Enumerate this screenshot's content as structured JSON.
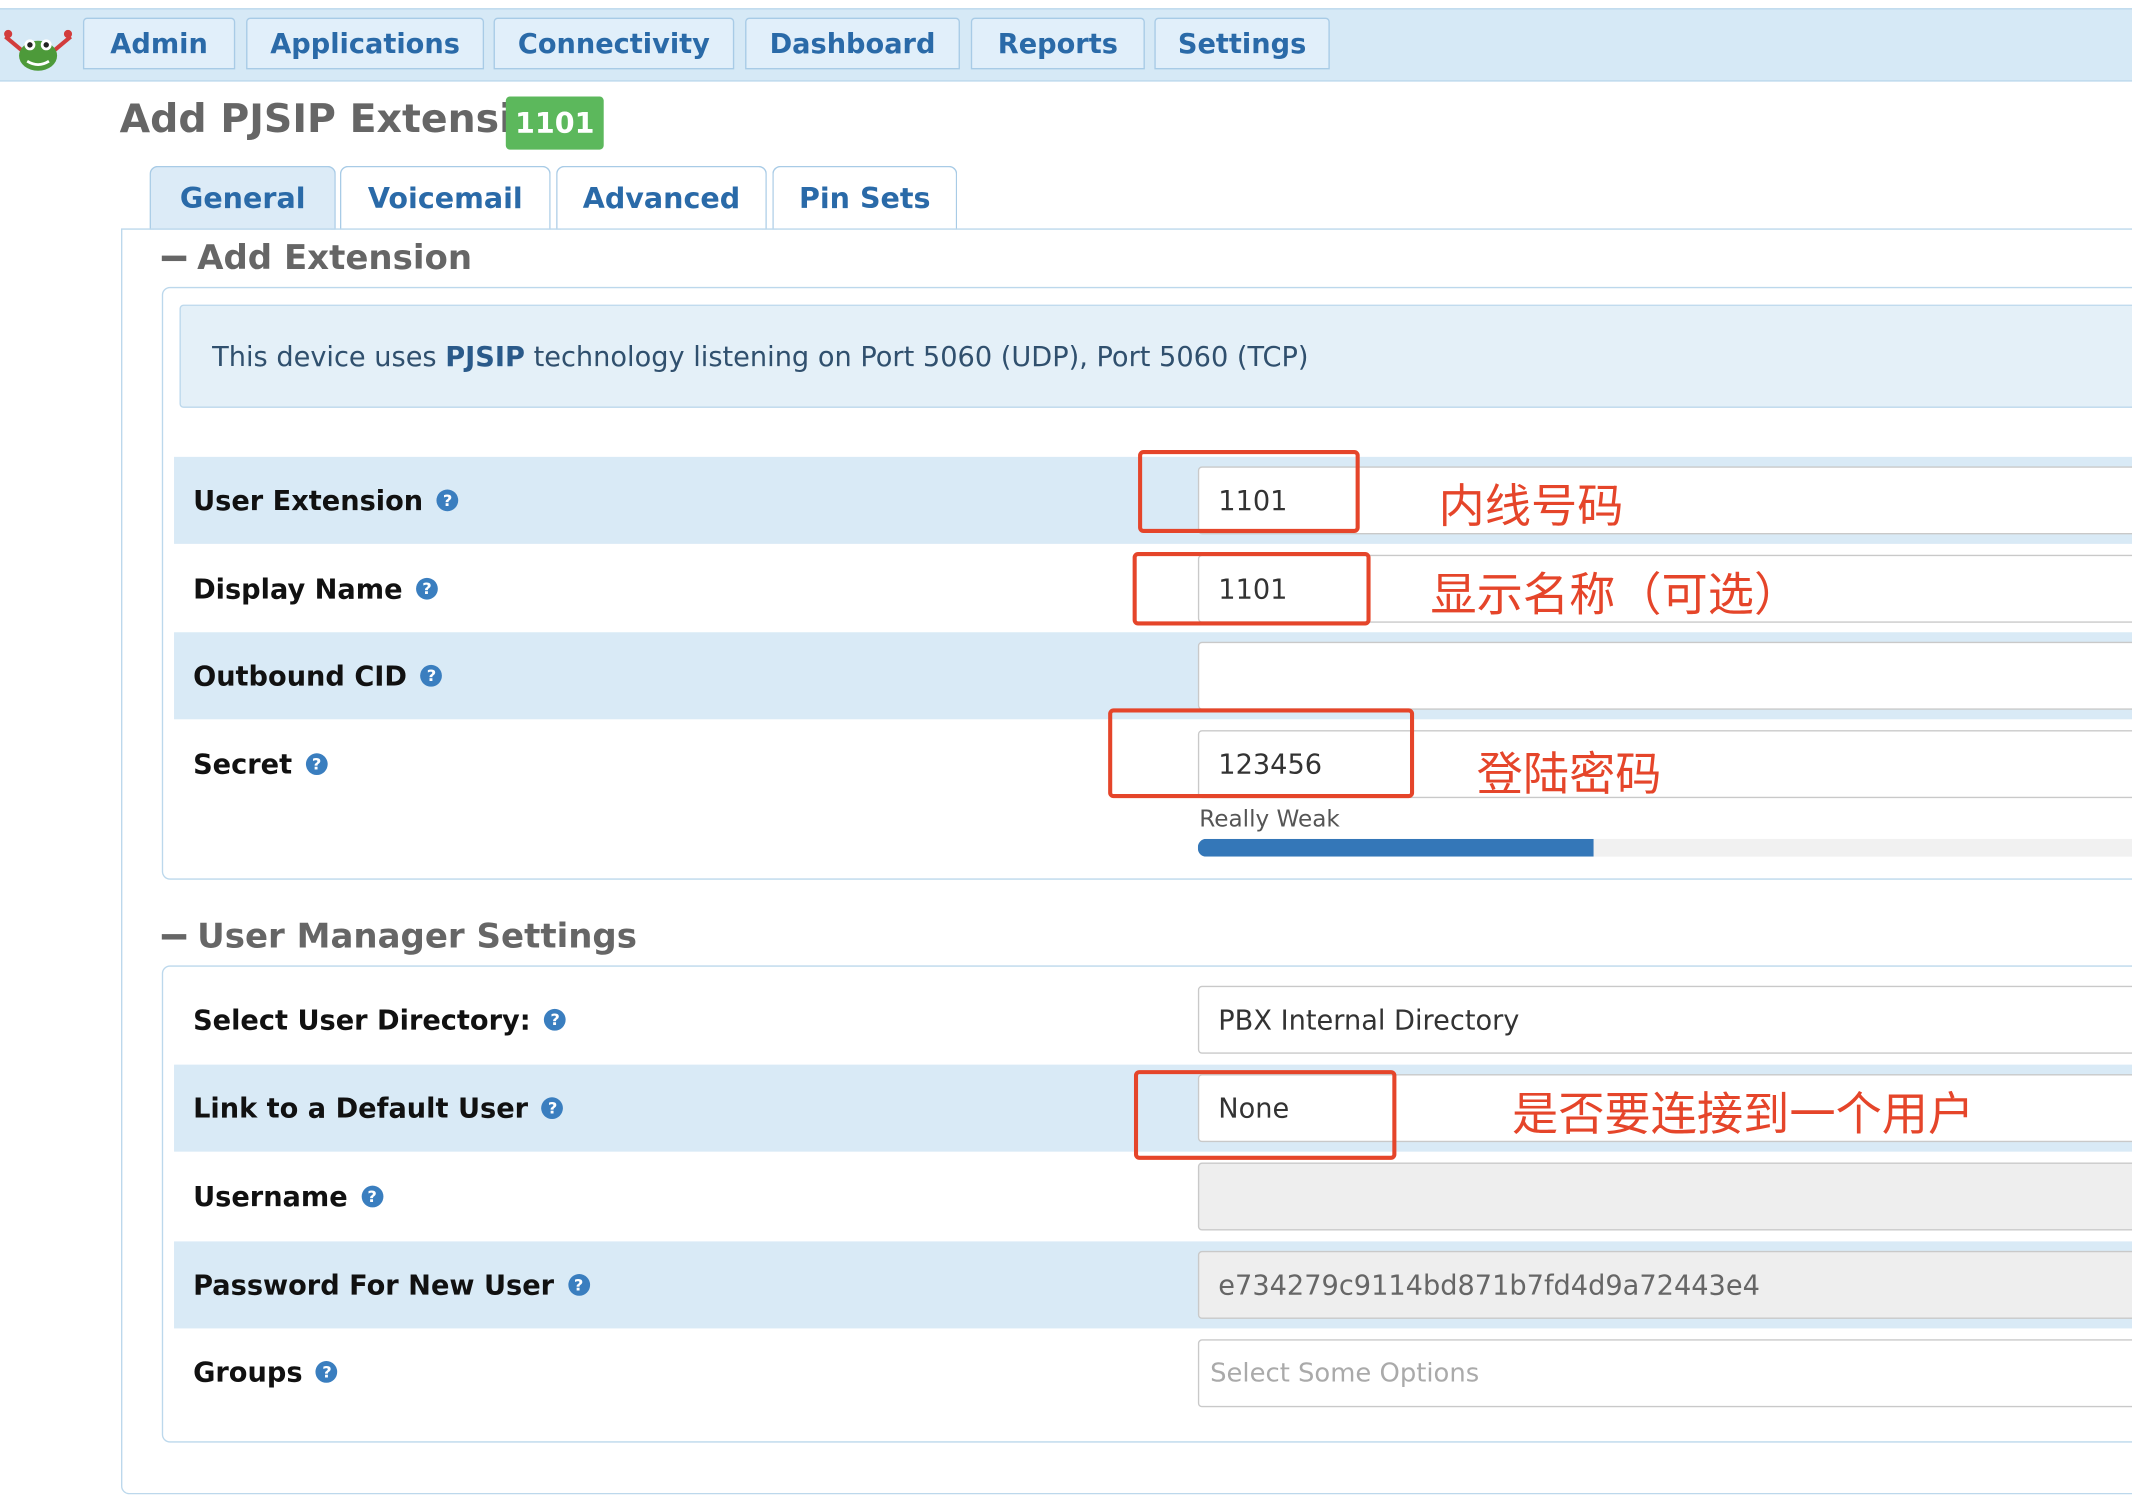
{
  "nav": {
    "items": [
      "Admin",
      "Applications",
      "Connectivity",
      "Dashboard",
      "Reports",
      "Settings"
    ]
  },
  "page": {
    "title": "Add PJSIP Extension",
    "extension_badge": "1101"
  },
  "tabs": [
    "General",
    "Voicemail",
    "Advanced",
    "Pin Sets"
  ],
  "active_tab": "General",
  "add_extension": {
    "title": "Add Extension",
    "info_prefix": "This device uses ",
    "info_tech": "PJSIP",
    "info_suffix": " technology listening on Port 5060 (UDP), Port 5060 (TCP)",
    "fields": {
      "user_extension": {
        "label": "User Extension",
        "value": "1101"
      },
      "display_name": {
        "label": "Display Name",
        "value": "1101"
      },
      "outbound_cid": {
        "label": "Outbound CID",
        "value": ""
      },
      "secret": {
        "label": "Secret",
        "value": "123456",
        "strength_label": "Really Weak",
        "strength_fraction": 0.415
      }
    }
  },
  "user_manager": {
    "title": "User Manager Settings",
    "fields": {
      "user_directory": {
        "label": "Select User Directory:",
        "value": "PBX Internal Directory"
      },
      "default_user": {
        "label": "Link to a Default User",
        "value": "None"
      },
      "username": {
        "label": "Username",
        "value": ""
      },
      "password": {
        "label": "Password For New User",
        "value": "e734279c9114bd871b7fd4d9a72443e4"
      },
      "groups": {
        "label": "Groups",
        "placeholder": "Select Some Options"
      }
    }
  },
  "annotations": {
    "extension": "内线号码",
    "display_name": "显示名称（可选）",
    "secret": "登陆密码",
    "default_user": "是否要连接到一个用户"
  },
  "colors": {
    "annotation": "#e5452a",
    "badge": "#5cb85c",
    "link": "#2a6aa8",
    "row_shade": "#d9eaf6"
  },
  "icons": {
    "logo": "freepbx-frog-logo",
    "help": "help-circle-icon",
    "collapse": "minus-icon"
  }
}
